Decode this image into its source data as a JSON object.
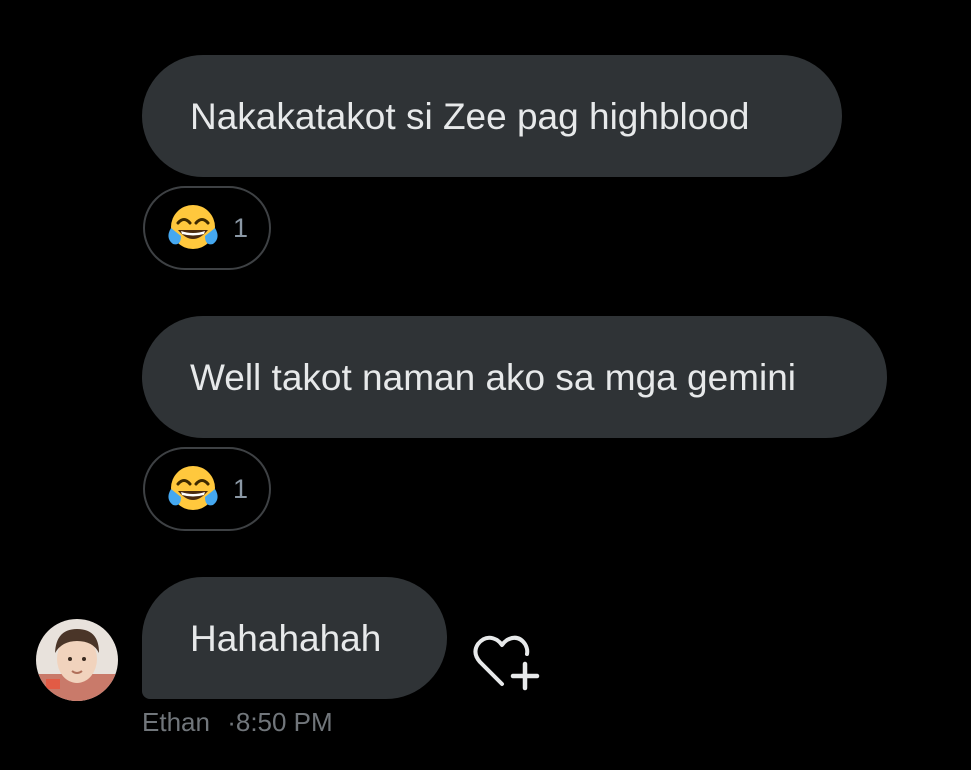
{
  "messages": [
    {
      "text": "Nakakatakot si Zee pag highblood",
      "reaction": {
        "emoji_icon": "face-with-tears-of-joy-icon",
        "count": "1"
      }
    },
    {
      "text": "Well takot naman ako sa mga gemini",
      "reaction": {
        "emoji_icon": "face-with-tears-of-joy-icon",
        "count": "1"
      }
    },
    {
      "text": "Hahahahah",
      "sender": "Ethan",
      "separator": "·",
      "time": "8:50 PM"
    }
  ],
  "colors": {
    "background": "#000000",
    "bubble": "#2f3336",
    "text": "#e7e9ea",
    "muted": "#71767b"
  },
  "icons": {
    "react_button": "heart-plus-icon",
    "avatar": "avatar"
  }
}
